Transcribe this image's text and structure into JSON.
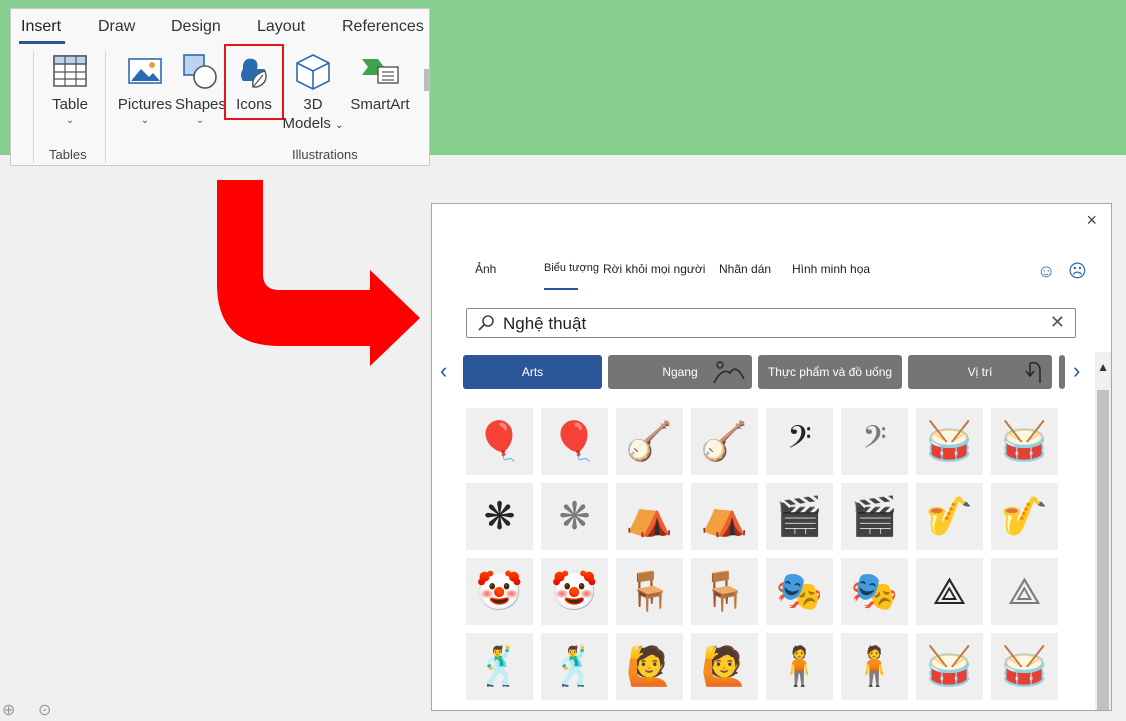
{
  "ribbon": {
    "tabs": [
      "Insert",
      "Draw",
      "Design",
      "Layout",
      "References"
    ],
    "buttons": {
      "table": "Table",
      "pictures": "Pictures",
      "shapes": "Shapes",
      "icons": "Icons",
      "models_line1": "3D",
      "models_line2": "Models",
      "smartart": "SmartArt"
    },
    "groups": {
      "tables": "Tables",
      "illustrations": "Illustrations"
    }
  },
  "dialog": {
    "tabs": [
      "Ảnh",
      "Biểu tượng",
      "Rời khỏi mọi người",
      "Nhãn dán",
      "Hình minh họa"
    ],
    "close": "×",
    "search": {
      "value": "Nghệ thuật",
      "clear": "✕"
    },
    "categories": [
      "Arts",
      "Ngang",
      "Thực phẩm và đồ uống",
      "Vị trí"
    ],
    "nav": {
      "prev": "‹",
      "next": "›"
    },
    "icon_grid": [
      [
        "balloon-dog-icon",
        "balloon-dog-outline-icon",
        "banjo-icon",
        "banjo-outline-icon",
        "bass-clef-icon",
        "bass-clef-outline-icon",
        "drum-icon",
        "drum-outline-icon"
      ],
      [
        "chinese-knot-icon",
        "chinese-knot-outline-icon",
        "circus-tent-icon",
        "circus-tent-outline-icon",
        "clapperboard-icon",
        "clapperboard-outline-icon",
        "clarinet-icon",
        "clarinet-outline-icon"
      ],
      [
        "clown-icon",
        "clown-outline-icon",
        "director-chair-icon",
        "director-chair-outline-icon",
        "theater-masks-icon",
        "theater-masks-outline-icon",
        "compass-icon",
        "compass-outline-icon"
      ],
      [
        "mannequin-icon",
        "mannequin-outline-icon",
        "mannequin-pointing-icon",
        "mannequin-pointing-outline-icon",
        "mannequin-hands-hips-icon",
        "mannequin-hands-hips-outline-icon",
        "snare-drum-icon",
        "snare-drum-outline-icon"
      ]
    ]
  }
}
